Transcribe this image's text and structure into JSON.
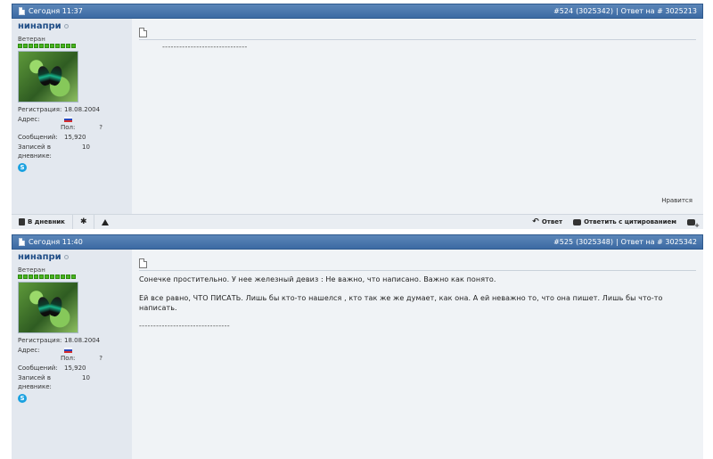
{
  "posts": [
    {
      "date": "Сегодня 11:37",
      "post_number": "#524",
      "post_id": "(3025342)",
      "separator": "|",
      "reply_to": "Ответ на # 3025213",
      "username": "нинапри",
      "rank": "Ветеран",
      "avatar": "butterfly-avatar",
      "registration_label": "Регистрация:",
      "registration_value": "18.08.2004",
      "address_label": "Адрес:",
      "gender_label": "Пол:",
      "gender_value": "?",
      "messages_label": "Сообщений:",
      "messages_value": "15,920",
      "diary_label": "Записей в дневнике:",
      "diary_value": "10",
      "content_lines": [],
      "signature": "------------------------------",
      "likes_label": "Нравится"
    },
    {
      "date": "Сегодня 11:40",
      "post_number": "#525",
      "post_id": "(3025348)",
      "separator": "|",
      "reply_to": "Ответ на # 3025342",
      "username": "нинапри",
      "rank": "Ветеран",
      "avatar": "butterfly-avatar",
      "registration_label": "Регистрация:",
      "registration_value": "18.08.2004",
      "address_label": "Адрес:",
      "gender_label": "Пол:",
      "gender_value": "?",
      "messages_label": "Сообщений:",
      "messages_value": "15,920",
      "diary_label": "Записей в дневнике:",
      "diary_value": "10",
      "content_lines": [
        "Сонечке простительно. У нее железный девиз : Не важно, что написано. Важно как понято.",
        "Ей все равно, ЧТО ПИСАТЬ. Лишь бы кто-то нашелся , кто так же же думает, как она. А ей неважно то, что она пишет. Лишь бы что-то написать."
      ],
      "signature": "--------------------------------",
      "likes_label": ""
    }
  ],
  "toolbar": {
    "diary_label": "В дневник",
    "reply_label": "Ответ",
    "quote_reply_label": "Ответить с цитированием"
  },
  "colors": {
    "header_bg": "#3c6aa3",
    "username": "#1f4d86",
    "reputation": "#49b520"
  }
}
